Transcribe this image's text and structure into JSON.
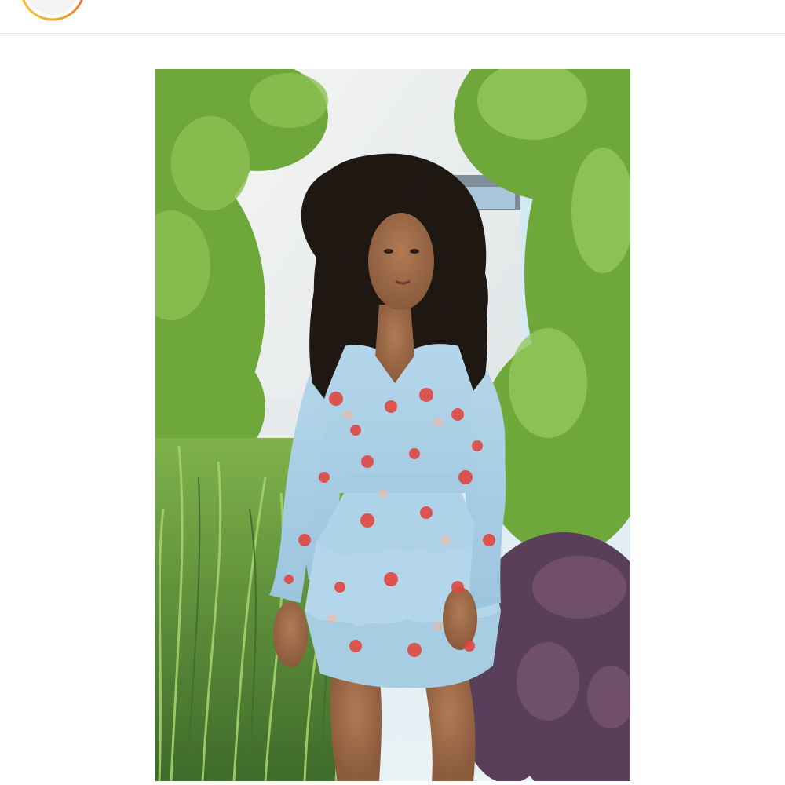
{
  "header": {
    "avatar_icon": "story-ring-avatar-icon",
    "ring_colors": [
      "#f9ce34",
      "#ee8a2a",
      "#ee2a7b"
    ]
  },
  "post": {
    "image_icon": "photo-woman-floral-dress",
    "colors": {
      "dress": "#a9cde3",
      "flowers": "#e0473f",
      "foliage": "#6fa83a",
      "wall": "#eef0ef",
      "shrub": "#5a3f5a"
    }
  }
}
